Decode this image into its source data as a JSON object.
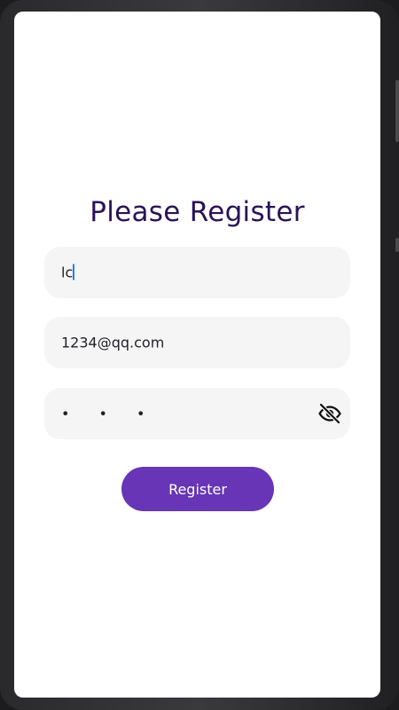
{
  "page": {
    "title": "Please Register"
  },
  "form": {
    "name": {
      "value": "lc"
    },
    "email": {
      "value": "1234@qq.com"
    },
    "password": {
      "masked_value": "• • •"
    },
    "register_label": "Register"
  },
  "icons": {
    "password_toggle": "eye-off-icon"
  },
  "colors": {
    "title": "#2a1259",
    "button": "#6735b5",
    "field_background": "#f5f5f5",
    "caret": "#2d7cf6"
  }
}
